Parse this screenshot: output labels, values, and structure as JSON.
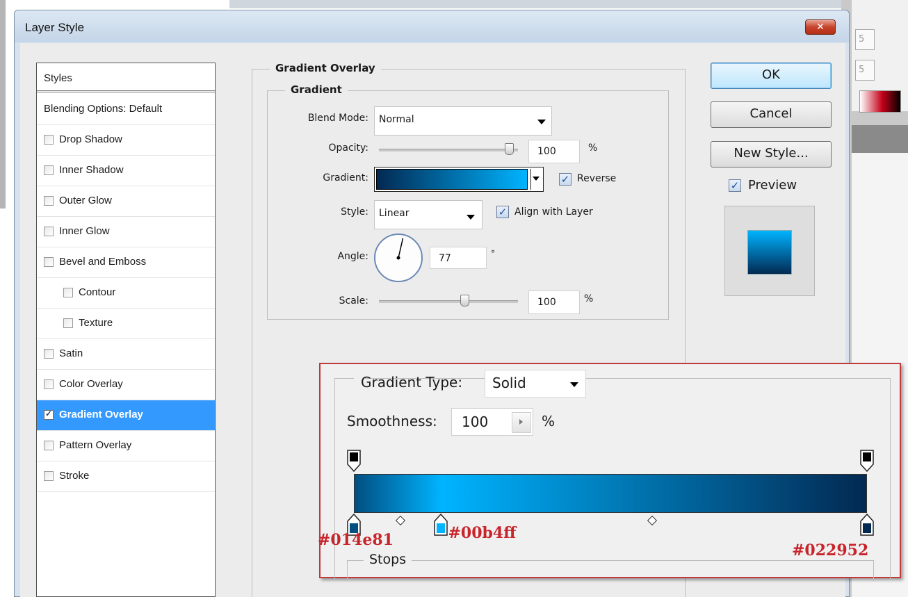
{
  "window": {
    "title": "Layer Style",
    "close_glyph": "✕"
  },
  "styles_list": {
    "header": "Styles",
    "items": [
      {
        "label": "Blending Options: Default",
        "has_checkbox": false,
        "checked": false,
        "selected": false,
        "indent": false
      },
      {
        "label": "Drop Shadow",
        "has_checkbox": true,
        "checked": false,
        "selected": false,
        "indent": false
      },
      {
        "label": "Inner Shadow",
        "has_checkbox": true,
        "checked": false,
        "selected": false,
        "indent": false
      },
      {
        "label": "Outer Glow",
        "has_checkbox": true,
        "checked": false,
        "selected": false,
        "indent": false
      },
      {
        "label": "Inner Glow",
        "has_checkbox": true,
        "checked": false,
        "selected": false,
        "indent": false
      },
      {
        "label": "Bevel and Emboss",
        "has_checkbox": true,
        "checked": false,
        "selected": false,
        "indent": false
      },
      {
        "label": "Contour",
        "has_checkbox": true,
        "checked": false,
        "selected": false,
        "indent": true
      },
      {
        "label": "Texture",
        "has_checkbox": true,
        "checked": false,
        "selected": false,
        "indent": true
      },
      {
        "label": "Satin",
        "has_checkbox": true,
        "checked": false,
        "selected": false,
        "indent": false
      },
      {
        "label": "Color Overlay",
        "has_checkbox": true,
        "checked": false,
        "selected": false,
        "indent": false
      },
      {
        "label": "Gradient Overlay",
        "has_checkbox": true,
        "checked": true,
        "selected": true,
        "indent": false
      },
      {
        "label": "Pattern Overlay",
        "has_checkbox": true,
        "checked": false,
        "selected": false,
        "indent": false
      },
      {
        "label": "Stroke",
        "has_checkbox": true,
        "checked": false,
        "selected": false,
        "indent": false
      }
    ]
  },
  "gradient_overlay": {
    "section_title": "Gradient Overlay",
    "group_title": "Gradient",
    "blend_mode": {
      "label": "Blend Mode:",
      "value": "Normal"
    },
    "opacity": {
      "label": "Opacity:",
      "value": "100",
      "unit": "%",
      "level": 1.0
    },
    "gradient": {
      "label": "Gradient:",
      "start_color": "#022952",
      "end_color": "#00b4ff"
    },
    "reverse": {
      "label": "Reverse",
      "checked": true
    },
    "style": {
      "label": "Style:",
      "value": "Linear"
    },
    "align_with_layer": {
      "label": "Align with Layer",
      "checked": true
    },
    "angle": {
      "label": "Angle:",
      "value": "77",
      "unit": "°",
      "degrees": 77
    },
    "scale": {
      "label": "Scale:",
      "value": "100",
      "unit": "%",
      "level": 0.62
    }
  },
  "buttons": {
    "ok": "OK",
    "cancel": "Cancel",
    "new_style": "New Style..."
  },
  "preview": {
    "label": "Preview",
    "checked": true
  },
  "gradient_editor": {
    "type_label": "Gradient Type:",
    "type_value": "Solid",
    "smoothness_label": "Smoothness:",
    "smoothness_value": "100",
    "smoothness_unit": "%",
    "stops_label": "Stops",
    "color_stops": [
      {
        "hex": "#014e81",
        "location": 0.0
      },
      {
        "hex": "#00b4ff",
        "location": 0.17
      },
      {
        "hex": "#022952",
        "location": 1.0
      }
    ],
    "midpoints": [
      0.09,
      0.58
    ],
    "opacity_stops": [
      0.0,
      1.0
    ]
  },
  "background_app": {
    "field_labels": [
      "5",
      "5"
    ]
  },
  "check_glyph": "✓",
  "icons": [
    "dropdown-arrow-icon",
    "check-icon",
    "close-icon",
    "angle-dial-icon",
    "slider-thumb-icon",
    "color-stop-icon",
    "opacity-stop-icon",
    "midpoint-diamond-icon",
    "stepper-arrow-icon"
  ]
}
